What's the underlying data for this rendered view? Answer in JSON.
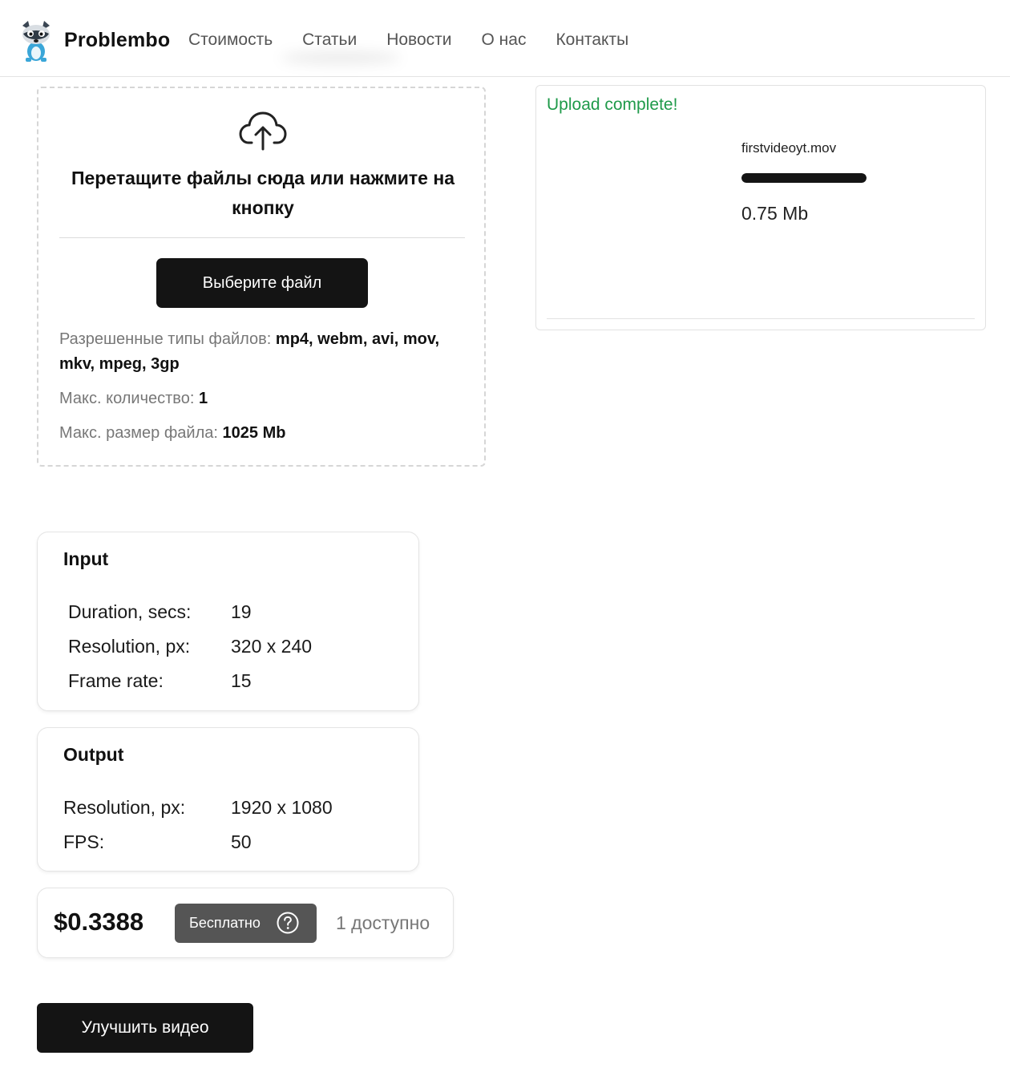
{
  "header": {
    "brand": "Problembo",
    "nav": [
      "Стоимость",
      "Статьи",
      "Новости",
      "О нас",
      "Контакты"
    ]
  },
  "dropzone": {
    "title": "Перетащите файлы сюда или нажмите на кнопку",
    "choose_button": "Выберите файл",
    "allowed_types_label": "Разрешенные типы файлов:",
    "allowed_types_value": "mp4, webm, avi, mov, mkv, mpeg, 3gp",
    "max_count_label": "Макс. количество:",
    "max_count_value": "1",
    "max_size_label": "Макс. размер файла:",
    "max_size_value": "1025 Mb"
  },
  "upload": {
    "status": "Upload complete!",
    "file_name": "firstvideoyt.mov",
    "progress_fraction": 1.0,
    "file_size": "0.75 Mb"
  },
  "input_card": {
    "title": "Input",
    "rows": [
      {
        "label": "Duration, secs:",
        "value": "19"
      },
      {
        "label": "Resolution, px:",
        "value": "320 x 240"
      },
      {
        "label": "Frame rate:",
        "value": "15"
      }
    ]
  },
  "output_card": {
    "title": "Output",
    "rows": [
      {
        "label": "Resolution, px:",
        "value": "1920 x 1080"
      },
      {
        "label": "FPS:",
        "value": "50"
      }
    ]
  },
  "pricing": {
    "price": "$0.3388",
    "free_label": "Бесплатно",
    "available": "1 доступно"
  },
  "improve_button": "Улучшить видео",
  "colors": {
    "success": "#1f9a4a",
    "primary_button": "#141414",
    "badge": "#555555"
  }
}
